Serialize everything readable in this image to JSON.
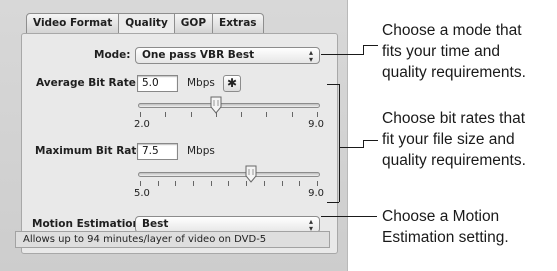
{
  "tabs": [
    {
      "label": "Video Format",
      "active": false
    },
    {
      "label": "Quality",
      "active": true
    },
    {
      "label": "GOP",
      "active": false
    },
    {
      "label": "Extras",
      "active": false
    }
  ],
  "mode": {
    "label": "Mode:",
    "value": "One pass VBR Best"
  },
  "average_bit_rate": {
    "label": "Average Bit Rate:",
    "value": "5.0",
    "unit": "Mbps",
    "slider": {
      "min_label": "2.0",
      "max_label": "9.0",
      "min": 2.0,
      "max": 9.0,
      "value": 5.0
    }
  },
  "maximum_bit_rate": {
    "label": "Maximum Bit Rate:",
    "value": "7.5",
    "unit": "Mbps",
    "slider": {
      "min_label": "5.0",
      "max_label": "9.0",
      "min": 5.0,
      "max": 9.0,
      "value": 7.5
    }
  },
  "motion_estimation": {
    "label": "Motion Estimation:",
    "value": "Best"
  },
  "info_text": "Allows up to 94 minutes/layer of video on DVD-5",
  "callouts": {
    "mode": [
      "Choose a mode that",
      "fits your time and",
      "quality requirements."
    ],
    "bitrate": [
      "Choose bit rates that",
      "fit your file size and",
      "quality requirements."
    ],
    "motion": [
      "Choose a Motion",
      "Estimation setting."
    ]
  },
  "icons": {
    "gear": "gear-icon",
    "popup_arrows": "popup-arrows-icon",
    "slider_thumb": "slider-thumb-icon"
  }
}
